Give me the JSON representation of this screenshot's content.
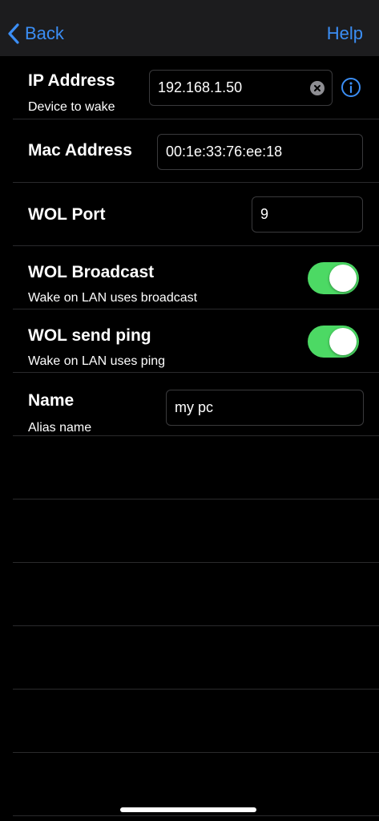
{
  "nav": {
    "back_label": "Back",
    "help_label": "Help"
  },
  "ip": {
    "label": "IP Address",
    "sublabel": "Device to wake",
    "value": "192.168.1.50"
  },
  "mac": {
    "label": "Mac Address",
    "value": "00:1e:33:76:ee:18"
  },
  "port": {
    "label": "WOL Port",
    "value": "9"
  },
  "broadcast": {
    "label": "WOL Broadcast",
    "sublabel": "Wake on LAN uses broadcast",
    "enabled": true
  },
  "ping": {
    "label": "WOL send ping",
    "sublabel": "Wake on LAN uses ping",
    "enabled": true
  },
  "name": {
    "label": "Name",
    "sublabel": "Alias name",
    "value": "my pc"
  },
  "colors": {
    "accent": "#3b8ef5",
    "toggle_on": "#4cd964",
    "background": "#000000",
    "navbar": "#1c1c1e"
  }
}
